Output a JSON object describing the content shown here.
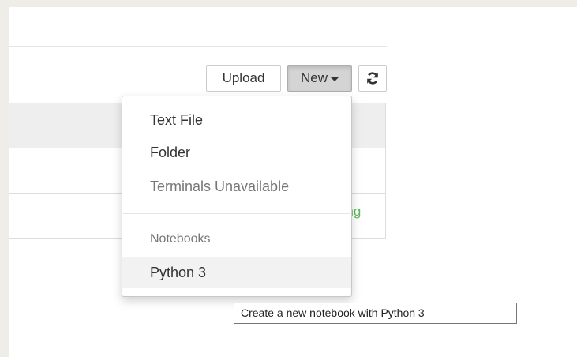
{
  "toolbar": {
    "upload_label": "Upload",
    "new_label": "New",
    "refresh_icon": "refresh-icon"
  },
  "file_list": {
    "row_status_partial": "Running"
  },
  "new_menu": {
    "items": [
      {
        "label": "Text File",
        "enabled": true
      },
      {
        "label": "Folder",
        "enabled": true
      },
      {
        "label": "Terminals Unavailable",
        "enabled": false
      }
    ],
    "section_header": "Notebooks",
    "notebook_items": [
      {
        "label": "Python 3",
        "hovered": true
      }
    ]
  },
  "tooltip": {
    "text": "Create a new notebook with Python 3"
  },
  "colors": {
    "running_green": "#5cb85c",
    "active_button_bg": "#d4d4d4",
    "menu_hover_bg": "#f2f2f2"
  }
}
